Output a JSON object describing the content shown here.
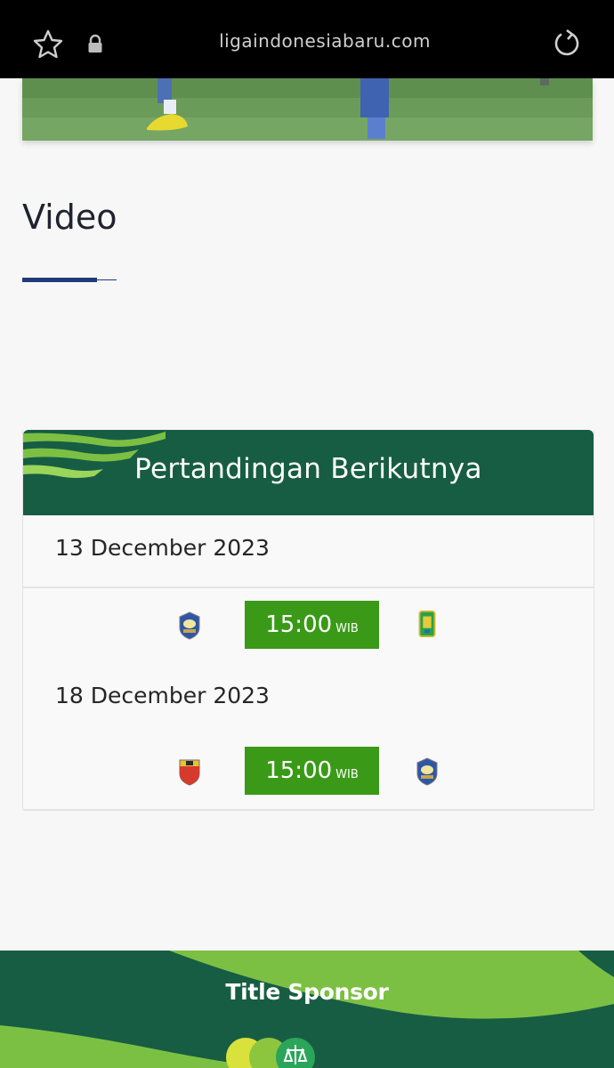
{
  "browser": {
    "url": "ligaindonesiabaru.com",
    "icons": [
      "star-icon",
      "lock-icon",
      "reload-icon"
    ]
  },
  "video_section": {
    "title": "Video"
  },
  "next_matches": {
    "title": "Pertandingan Berikutnya",
    "fixtures": [
      {
        "date": "13 December 2023",
        "time": "15:00",
        "timezone": "WIB",
        "home_logo": "blue-club-crest-icon",
        "away_logo": "green-yellow-club-crest-icon"
      },
      {
        "date": "18 December 2023",
        "time": "15:00",
        "timezone": "WIB",
        "home_logo": "red-yellow-club-crest-icon",
        "away_logo": "blue-club-crest-icon"
      }
    ]
  },
  "footer": {
    "sponsor_title": "Title Sponsor"
  },
  "colors": {
    "header_green": "#175d44",
    "time_green": "#3a9a17",
    "accent_light_green": "#7cc043",
    "underline_blue": "#1f3a78"
  }
}
